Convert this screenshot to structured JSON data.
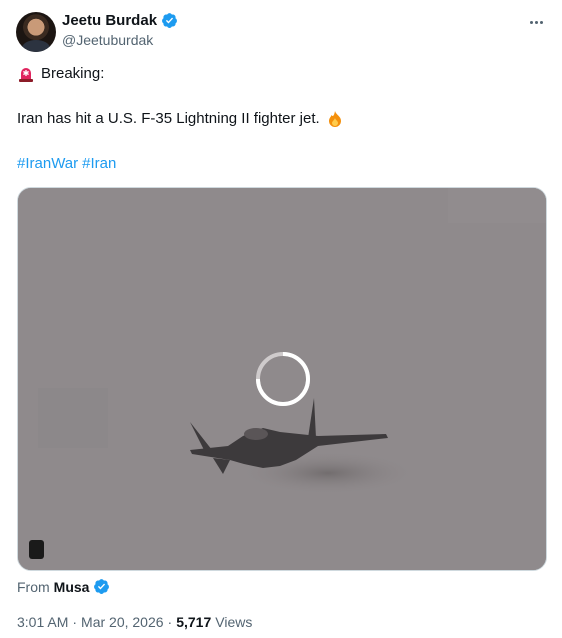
{
  "author": {
    "display_name": "Jeetu Burdak",
    "handle": "@Jeetuburdak",
    "verified": true,
    "avatar_icon": "avatar"
  },
  "tweet": {
    "emoji_siren": "🚨",
    "breaking": "Breaking:",
    "body": "Iran has hit a U.S. F-35 Lightning II fighter jet.",
    "emoji_fire": "🔥",
    "hashtags": [
      "#IranWar",
      "#Iran"
    ]
  },
  "media": {
    "type": "video",
    "state": "loading",
    "icons": [
      "loading-spinner-icon",
      "fighter-jet-image"
    ]
  },
  "source": {
    "label": "From",
    "name": "Musa",
    "verified": true
  },
  "meta": {
    "time": "3:01 AM",
    "date": "Mar 20, 2026",
    "views_count": "5,717",
    "views_label": "Views",
    "separator": "·"
  },
  "colors": {
    "accent": "#1d9bf0",
    "text": "#0f1419",
    "secondary": "#536471",
    "border": "#cfd9de"
  }
}
